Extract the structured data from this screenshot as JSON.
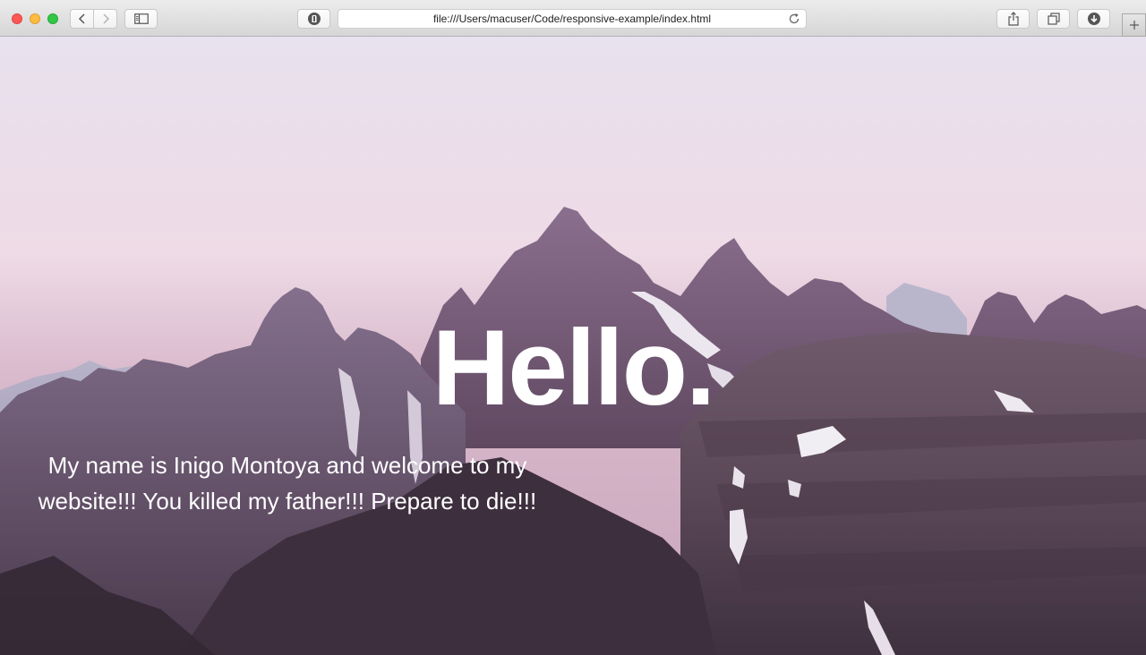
{
  "browser": {
    "address_url": "file:///Users/macuser/Code/responsive-example/index.html",
    "icons": {
      "back": "chevron-left-icon",
      "forward": "chevron-right-icon",
      "sidebar": "sidebar-icon",
      "privacy": "shield-icon",
      "reload": "reload-icon",
      "share": "share-icon",
      "tabs": "tabs-overview-icon",
      "downloads": "download-icon",
      "new_tab": "plus-icon"
    },
    "colors": {
      "close": "#fc5753",
      "minimize": "#fdbc40",
      "zoom": "#33c748"
    }
  },
  "page": {
    "heading": "Hello.",
    "intro": "My name is Inigo Montoya and welcome to my website!!! You killed my father!!! Prepare to die!!!",
    "background": "mountain-landscape-photo"
  }
}
